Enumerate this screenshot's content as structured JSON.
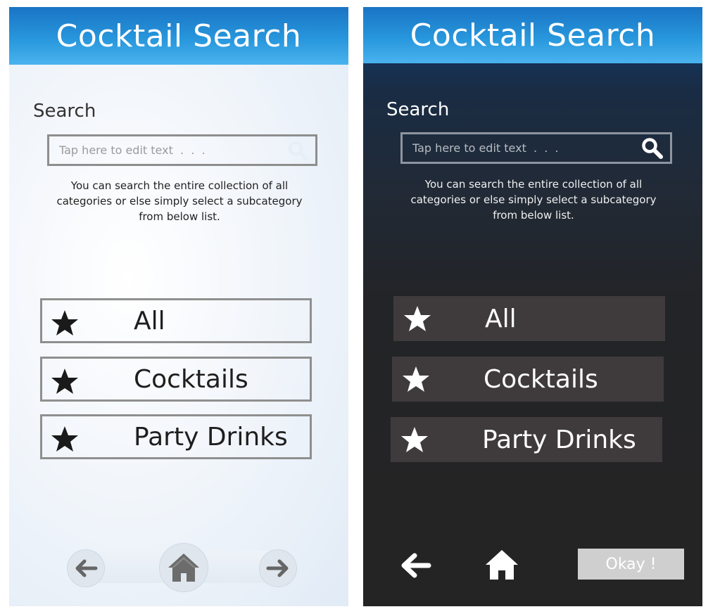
{
  "screens": [
    {
      "theme": "light",
      "header": {
        "title": "Cocktail Search"
      },
      "search": {
        "label": "Search",
        "placeholder": "Tap here to edit text  .  .  .",
        "helper": "You can search the entire collection of all categories or else simply select a subcategory from below list."
      },
      "categories": [
        {
          "label": "All"
        },
        {
          "label": "Cocktails"
        },
        {
          "label": "Party Drinks"
        }
      ],
      "nav": {
        "back_icon": "arrow-left-icon",
        "home_icon": "home-icon",
        "forward_icon": "arrow-right-icon"
      }
    },
    {
      "theme": "dark",
      "header": {
        "title": "Cocktail Search"
      },
      "search": {
        "label": "Search",
        "placeholder": "Tap here to edit text  .  .  .",
        "helper": "You can search the entire collection of all categories or else simply select a subcategory from below list."
      },
      "categories": [
        {
          "label": "All"
        },
        {
          "label": "Cocktails"
        },
        {
          "label": "Party Drinks"
        }
      ],
      "nav": {
        "back_icon": "arrow-left-icon",
        "home_icon": "home-icon",
        "okay_label": "Okay !"
      }
    }
  ],
  "colors": {
    "header_top": "#1a74c4",
    "header_bottom": "#49b3ee",
    "dark_item_bg": "#3f3b3d",
    "light_border": "#8f8f8f",
    "okay_bg": "#cfcfcf"
  }
}
